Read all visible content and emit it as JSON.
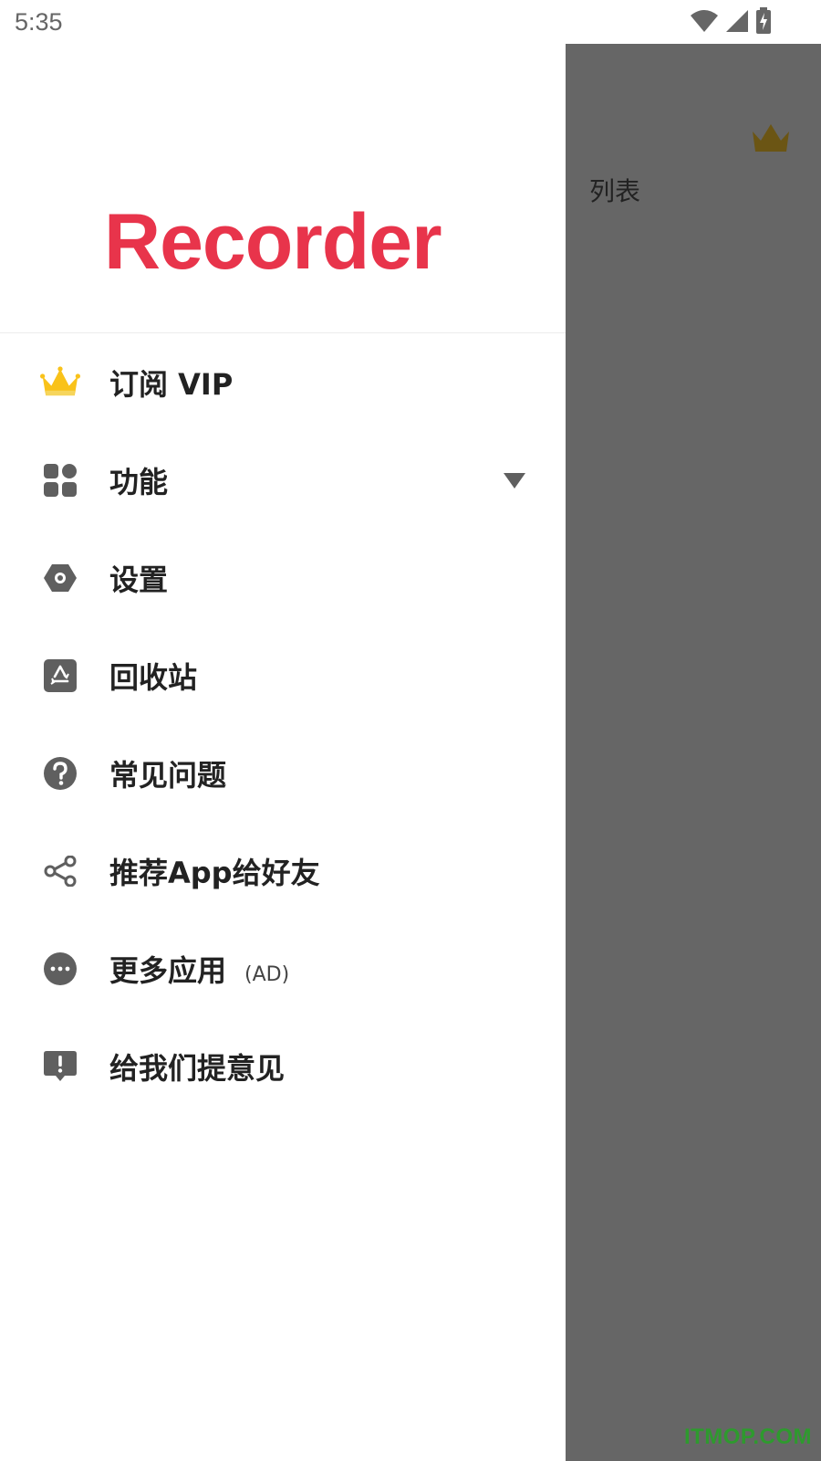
{
  "status_bar": {
    "time": "5:35",
    "icons": [
      "wifi-icon",
      "cellular-signal-icon",
      "battery-charging-icon"
    ]
  },
  "background_screen": {
    "title": "列表",
    "crown_icon": "crown-icon",
    "scrim_color": "#666666"
  },
  "drawer": {
    "brand": "Recorder",
    "brand_color": "#e8344b",
    "items": [
      {
        "label": "订阅 VIP",
        "icon": "crown-icon"
      },
      {
        "label": "功能",
        "icon": "grid-icon",
        "has_expand": true
      },
      {
        "label": "设置",
        "icon": "settings-hexagon-icon"
      },
      {
        "label": "回收站",
        "icon": "recycle-icon"
      },
      {
        "label": "常见问题",
        "icon": "help-icon"
      },
      {
        "label": "推荐App给好友",
        "icon": "share-icon"
      },
      {
        "label": "更多应用",
        "suffix": "(AD)",
        "icon": "more-horizontal-icon"
      },
      {
        "label": "给我们提意见",
        "icon": "feedback-icon"
      }
    ]
  },
  "watermark": "ITMOP.COM"
}
